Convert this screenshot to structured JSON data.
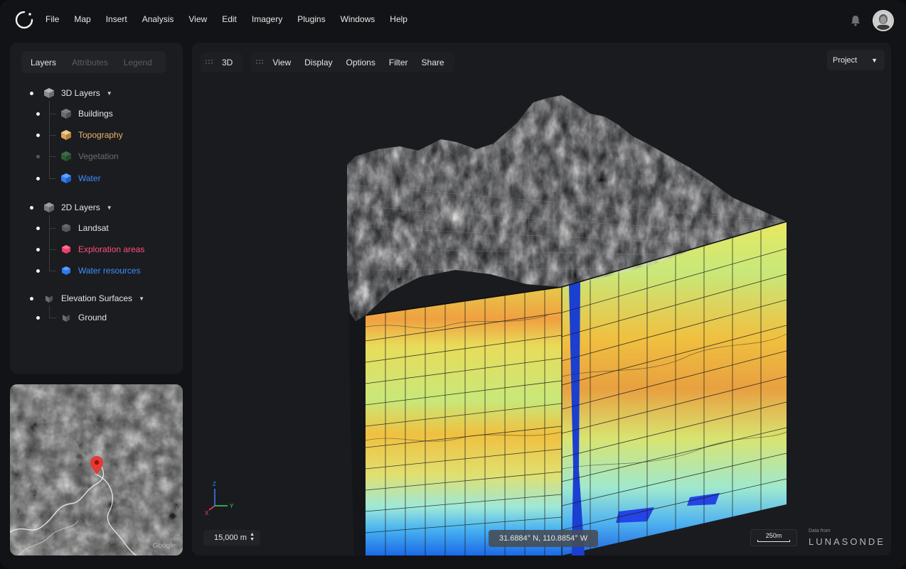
{
  "menu": [
    "File",
    "Map",
    "Insert",
    "Analysis",
    "View",
    "Edit",
    "Imagery",
    "Plugins",
    "Windows",
    "Help"
  ],
  "panel": {
    "tabs": [
      "Layers",
      "Attributes",
      "Legend"
    ],
    "groups": {
      "layers3d": "3D Layers",
      "layers2d": "2D Layers",
      "elevation": "Elevation Surfaces"
    },
    "items": {
      "buildings": "Buildings",
      "topography": "Topography",
      "vegetation": "Vegetation",
      "water": "Water",
      "landsat": "Landsat",
      "exploration": "Exploration areas",
      "water_resources": "Water resources",
      "ground": "Ground"
    }
  },
  "colors": {
    "topography": "#e8b46e",
    "water": "#3d8dff",
    "exploration": "#ff4f7a",
    "vegetation_dim": "#6b6c71"
  },
  "minimap": {
    "attribution": "Google"
  },
  "toolbar": {
    "mode": "3D",
    "items": [
      "View",
      "Display",
      "Options",
      "Filter",
      "Share"
    ]
  },
  "project_select": "Project",
  "axes": {
    "x": "X",
    "y": "Y",
    "z": "Z"
  },
  "scale_input": "15,000 m",
  "coordinates": "31.6884° N, 110.8854° W",
  "scale_bar": "250m",
  "credit": {
    "prefix": "Data from",
    "brand": "LUNASONDE"
  }
}
